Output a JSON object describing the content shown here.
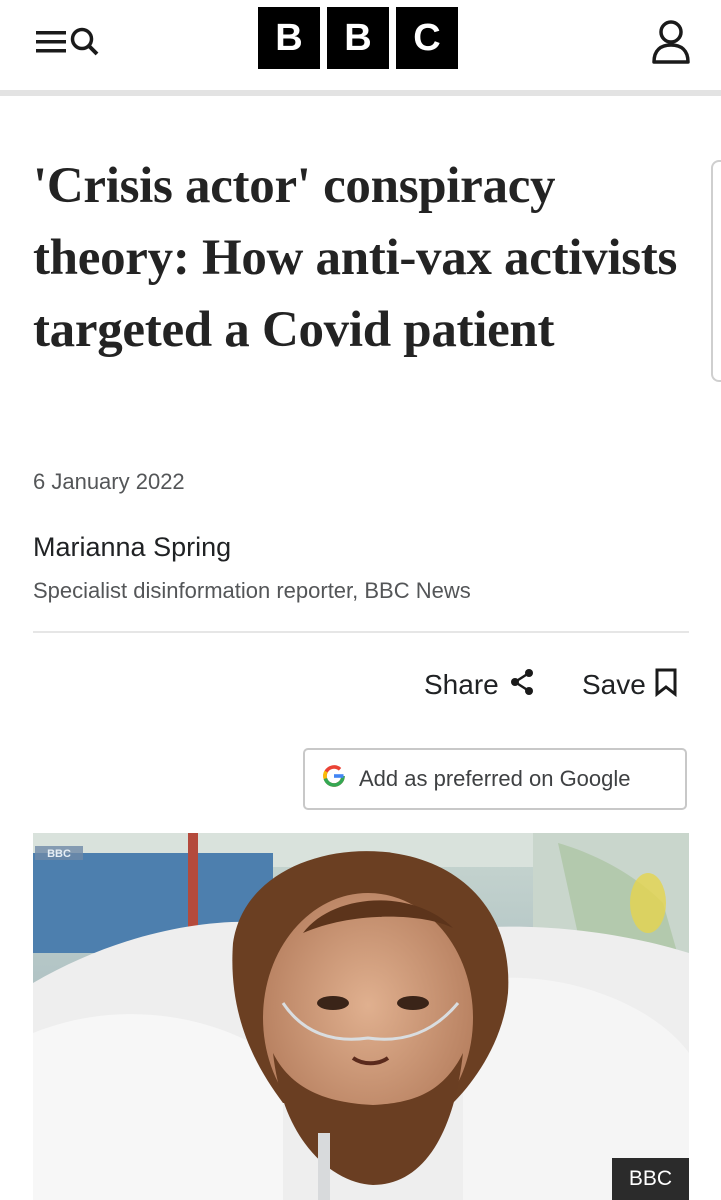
{
  "header": {
    "logo_letters": [
      "B",
      "B",
      "C"
    ],
    "menu_icon": "menu-icon",
    "search_icon": "search-icon",
    "account_icon": "user-account-icon"
  },
  "article": {
    "headline": "'Crisis actor' conspiracy theory: How anti-vax activists targeted a Covid patient",
    "date": "6 January 2022",
    "author": "Marianna Spring",
    "author_role": "Specialist disinformation reporter, BBC News"
  },
  "actions": {
    "share_label": "Share",
    "share_icon": "share-icon",
    "save_label": "Save",
    "save_icon": "bookmark-icon"
  },
  "preferred_source": {
    "label": "Add as preferred on Google",
    "icon": "google-g-icon"
  },
  "image": {
    "caption_badge": "BBC",
    "watermark": "BBC"
  },
  "colors": {
    "text": "#202224",
    "secondary_text": "#545658",
    "logo_background": "#000000",
    "header_rule": "#e3e3e3"
  }
}
